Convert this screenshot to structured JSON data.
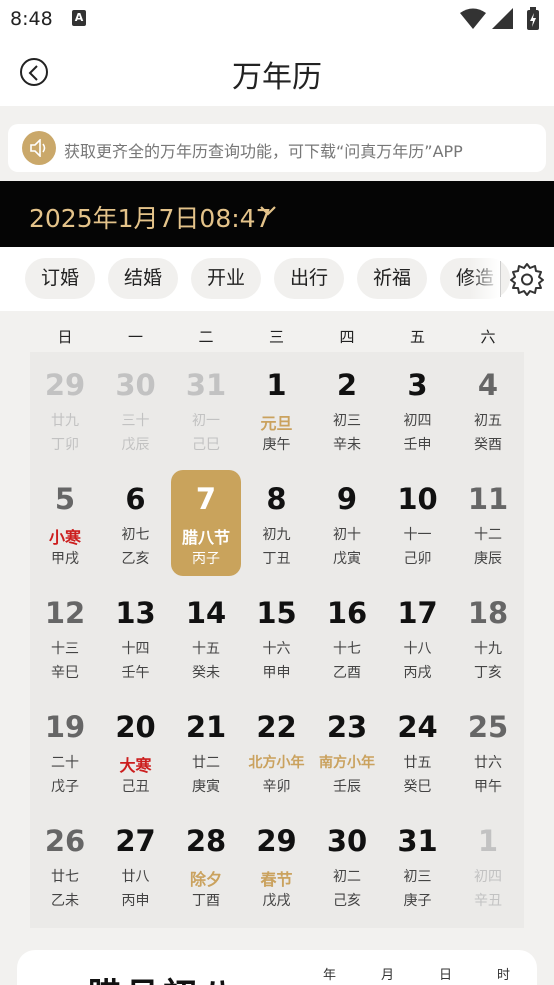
{
  "status": {
    "time": "8:48",
    "a_icon_label": "A",
    "icons": [
      "wifi-icon",
      "signal-icon",
      "battery-icon"
    ]
  },
  "header": {
    "title": "万年历"
  },
  "notice": {
    "text": "获取更齐全的万年历查询功能，可下载“问真万年历”APP"
  },
  "datebar": {
    "date": "2025年1月7日08:47"
  },
  "chips": [
    "订婚",
    "结婚",
    "开业",
    "出行",
    "祈福",
    "修造"
  ],
  "weekdays": [
    "日",
    "一",
    "二",
    "三",
    "四",
    "五",
    "六"
  ],
  "calendar": [
    [
      {
        "d": "29",
        "l1": "廿九",
        "l2": "丁卯",
        "other": true
      },
      {
        "d": "30",
        "l1": "三十",
        "l2": "戊辰",
        "other": true
      },
      {
        "d": "31",
        "l1": "初一",
        "l2": "己巳",
        "other": true
      },
      {
        "d": "1",
        "l1": "元旦",
        "l2": "庚午",
        "hl": "gold"
      },
      {
        "d": "2",
        "l1": "初三",
        "l2": "辛未"
      },
      {
        "d": "3",
        "l1": "初四",
        "l2": "壬申"
      },
      {
        "d": "4",
        "l1": "初五",
        "l2": "癸酉"
      }
    ],
    [
      {
        "d": "5",
        "l1": "小寒",
        "l2": "甲戌",
        "hl": "red"
      },
      {
        "d": "6",
        "l1": "初七",
        "l2": "乙亥"
      },
      {
        "d": "7",
        "l1": "腊八节",
        "l2": "丙子",
        "sel": true
      },
      {
        "d": "8",
        "l1": "初九",
        "l2": "丁丑"
      },
      {
        "d": "9",
        "l1": "初十",
        "l2": "戊寅"
      },
      {
        "d": "10",
        "l1": "十一",
        "l2": "己卯"
      },
      {
        "d": "11",
        "l1": "十二",
        "l2": "庚辰"
      }
    ],
    [
      {
        "d": "12",
        "l1": "十三",
        "l2": "辛巳"
      },
      {
        "d": "13",
        "l1": "十四",
        "l2": "壬午"
      },
      {
        "d": "14",
        "l1": "十五",
        "l2": "癸未"
      },
      {
        "d": "15",
        "l1": "十六",
        "l2": "甲申"
      },
      {
        "d": "16",
        "l1": "十七",
        "l2": "乙酉"
      },
      {
        "d": "17",
        "l1": "十八",
        "l2": "丙戌"
      },
      {
        "d": "18",
        "l1": "十九",
        "l2": "丁亥"
      }
    ],
    [
      {
        "d": "19",
        "l1": "二十",
        "l2": "戊子"
      },
      {
        "d": "20",
        "l1": "大寒",
        "l2": "己丑",
        "hl": "red"
      },
      {
        "d": "21",
        "l1": "廿二",
        "l2": "庚寅"
      },
      {
        "d": "22",
        "l1": "北方小年",
        "l2": "辛卯",
        "hl": "gold-small"
      },
      {
        "d": "23",
        "l1": "南方小年",
        "l2": "壬辰",
        "hl": "gold-small"
      },
      {
        "d": "24",
        "l1": "廿五",
        "l2": "癸巳"
      },
      {
        "d": "25",
        "l1": "廿六",
        "l2": "甲午"
      }
    ],
    [
      {
        "d": "26",
        "l1": "廿七",
        "l2": "乙未"
      },
      {
        "d": "27",
        "l1": "廿八",
        "l2": "丙申"
      },
      {
        "d": "28",
        "l1": "除夕",
        "l2": "丁酉",
        "hl": "gold"
      },
      {
        "d": "29",
        "l1": "春节",
        "l2": "戊戌",
        "hl": "gold"
      },
      {
        "d": "30",
        "l1": "初二",
        "l2": "己亥"
      },
      {
        "d": "31",
        "l1": "初三",
        "l2": "庚子"
      },
      {
        "d": "1",
        "l1": "初四",
        "l2": "辛丑",
        "other": true
      }
    ]
  ],
  "bottom": {
    "title": "腊月初八",
    "cols": [
      "年",
      "月",
      "日",
      "时"
    ]
  },
  "colors": {
    "gold": "#c9a35c",
    "black": "#050505",
    "red": "#cc1e1e"
  }
}
